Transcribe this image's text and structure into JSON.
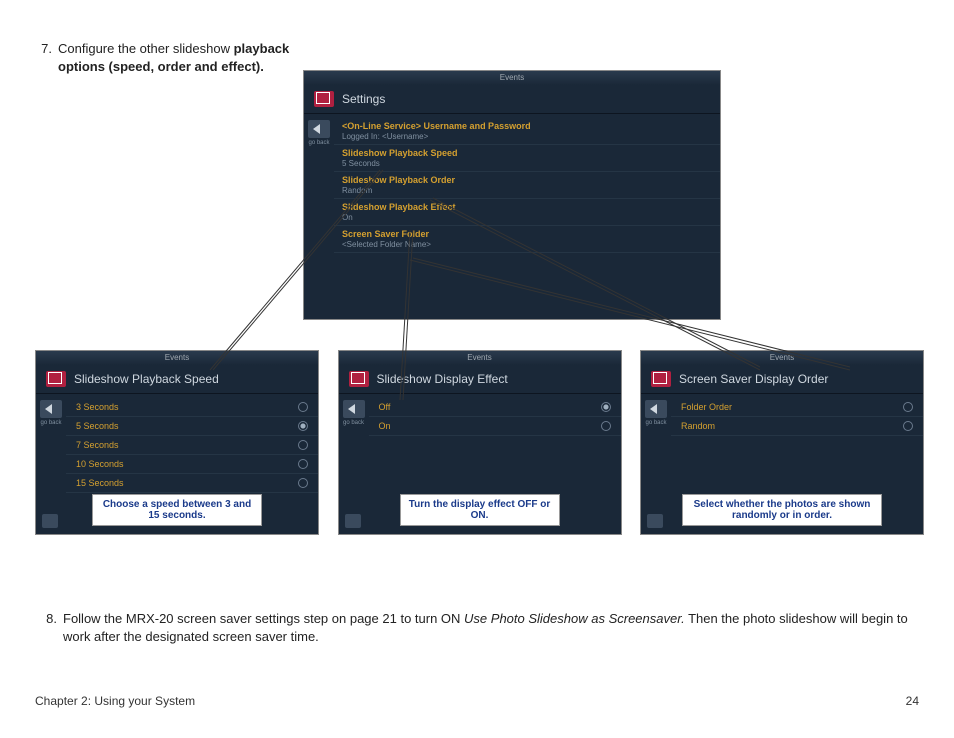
{
  "step7": {
    "num": "7.",
    "text_a": "Configure the other slideshow ",
    "text_b": "playback options (speed, order and effect)."
  },
  "main": {
    "header": "Events",
    "title": "Settings",
    "back": "go back",
    "items": [
      {
        "t": "<On-Line Service> Username and Password",
        "s": "Logged In: <Username>"
      },
      {
        "t": "Slideshow Playback Speed",
        "s": "5 Seconds"
      },
      {
        "t": "Slideshow Playback Order",
        "s": "Random"
      },
      {
        "t": "Slideshow Playback Effect",
        "s": "On"
      },
      {
        "t": "Screen Saver Folder",
        "s": "<Selected Folder Name>"
      }
    ]
  },
  "sub1": {
    "header": "Events",
    "title": "Slideshow Playback Speed",
    "back": "go back",
    "opts": [
      {
        "l": "3 Seconds",
        "sel": false
      },
      {
        "l": "5 Seconds",
        "sel": true
      },
      {
        "l": "7 Seconds",
        "sel": false
      },
      {
        "l": "10 Seconds",
        "sel": false
      },
      {
        "l": "15 Seconds",
        "sel": false
      }
    ],
    "caption": "Choose a speed between 3 and 15 seconds."
  },
  "sub2": {
    "header": "Events",
    "title": "Slideshow Display Effect",
    "back": "go back",
    "opts": [
      {
        "l": "Off",
        "sel": true
      },
      {
        "l": "On",
        "sel": false
      }
    ],
    "caption": "Turn the display effect OFF or ON."
  },
  "sub3": {
    "header": "Events",
    "title": "Screen Saver Display Order",
    "back": "go back",
    "opts": [
      {
        "l": "Folder Order",
        "sel": false
      },
      {
        "l": "Random",
        "sel": false
      }
    ],
    "caption": "Select whether the photos are shown randomly or in order."
  },
  "step8": {
    "num": "8.",
    "a": "Follow the MRX-20 screen saver settings step on page 21 to turn ON ",
    "b": "Use Photo Slideshow as Screensaver.",
    "c": "  Then the photo slideshow will begin to work after the designated screen saver time."
  },
  "footer": {
    "left": "Chapter 2: Using your System",
    "right": "24"
  }
}
